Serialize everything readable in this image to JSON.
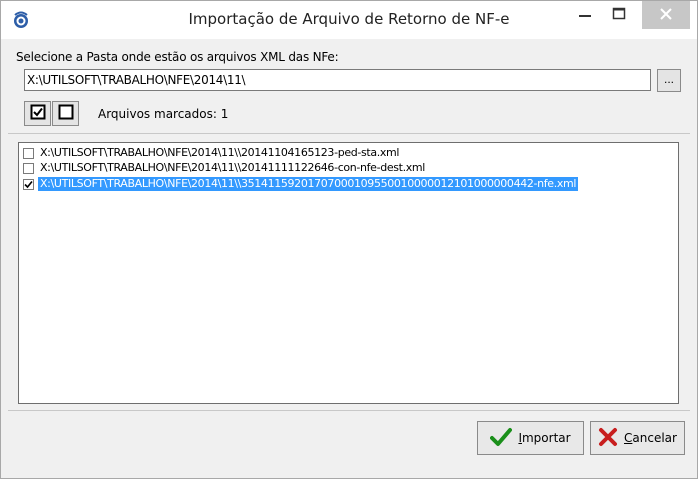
{
  "window": {
    "title": "Importação de Arquivo de Retorno de NF-e"
  },
  "folder": {
    "label": "Selecione a Pasta onde estão os arquivos XML das NFe:",
    "value": "X:\\UTILSOFT\\TRABALHO\\NFE\\2014\\11\\",
    "browse_label": "..."
  },
  "marked": {
    "text": "Arquivos marcados: 1"
  },
  "files": [
    {
      "path": "X:\\UTILSOFT\\TRABALHO\\NFE\\2014\\11\\\\20141104165123-ped-sta.xml",
      "checked": false,
      "selected": false
    },
    {
      "path": "X:\\UTILSOFT\\TRABALHO\\NFE\\2014\\11\\\\20141111122646-con-nfe-dest.xml",
      "checked": false,
      "selected": false
    },
    {
      "path": "X:\\UTILSOFT\\TRABALHO\\NFE\\2014\\11\\\\35141159201707000109550010000012101000000442-nfe.xml",
      "checked": true,
      "selected": true
    }
  ],
  "buttons": {
    "import_accel": "I",
    "import_rest": "mportar",
    "cancel_accel": "C",
    "cancel_rest": "ancelar"
  },
  "colors": {
    "selection": "#3399ff",
    "import_check": "#1a8f1a",
    "cancel_x": "#c81e1e"
  },
  "icons": {
    "app": "app-logo-icon",
    "minimize": "minimize-icon",
    "maximize": "maximize-icon",
    "close": "close-icon",
    "check_all": "check-all-icon",
    "uncheck_all": "uncheck-all-icon",
    "import": "green-check-icon",
    "cancel": "red-x-icon"
  }
}
